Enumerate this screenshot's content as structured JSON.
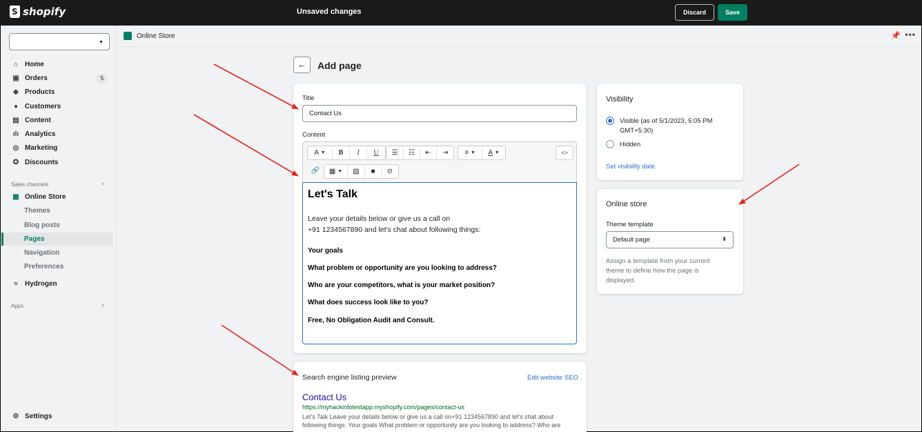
{
  "topbar": {
    "logo_text": "shopify",
    "status": "Unsaved changes",
    "discard_label": "Discard",
    "save_label": "Save"
  },
  "sidebar": {
    "store_select_value": "",
    "nav": [
      {
        "label": "Home",
        "icon": "home-icon"
      },
      {
        "label": "Orders",
        "icon": "orders-icon",
        "badge": "5"
      },
      {
        "label": "Products",
        "icon": "products-icon"
      },
      {
        "label": "Customers",
        "icon": "customers-icon"
      },
      {
        "label": "Content",
        "icon": "content-icon"
      },
      {
        "label": "Analytics",
        "icon": "analytics-icon"
      },
      {
        "label": "Marketing",
        "icon": "marketing-icon"
      },
      {
        "label": "Discounts",
        "icon": "discounts-icon"
      }
    ],
    "sales_channels_label": "Sales channels",
    "online_store_label": "Online Store",
    "online_store_sub": [
      "Themes",
      "Blog posts",
      "Pages",
      "Navigation",
      "Preferences"
    ],
    "active_sub": "Pages",
    "hydrogen_label": "Hydrogen",
    "apps_label": "Apps",
    "settings_label": "Settings"
  },
  "breadcrumb": {
    "label": "Online Store"
  },
  "page": {
    "title": "Add page"
  },
  "main_card": {
    "title_label": "Title",
    "title_value": "Contact Us",
    "content_label": "Content",
    "editor": {
      "heading": "Let's Talk",
      "para_line1": "Leave your details below or give us a call on",
      "para_line2": "+91 1234567890 and let's chat about following things:",
      "bold_items": [
        "Your goals",
        "What problem or opportunity are you looking to address?",
        "Who are your competitors, what is your market position?",
        "What does success look like to you?",
        "Free, No Obligation Audit and Consult."
      ]
    },
    "toolbar": {
      "font_label": "A",
      "bold_label": "B",
      "italic_label": "I",
      "underline_label": "U",
      "color_label": "A",
      "html_label": "<>"
    }
  },
  "seo_card": {
    "heading": "Search engine listing preview",
    "edit_link": "Edit website SEO",
    "preview_title": "Contact Us",
    "preview_url": "https://myhackinfotestapp.myshopify.com/pages/contact-us",
    "preview_desc": "Let's Talk Leave your details below or give us a call on+91 1234567890 and let's chat about following things: Your goals What problem or opportunity are you looking to address? Who are"
  },
  "visibility_card": {
    "heading": "Visibility",
    "visible_label": "Visible (as of 5/1/2023, 5:05 PM",
    "visible_label_2": "GMT+5:30)",
    "hidden_label": "Hidden",
    "selected": "Visible",
    "set_date_link": "Set visibility date"
  },
  "online_store_card": {
    "heading": "Online store",
    "template_label": "Theme template",
    "template_value": "Default page",
    "help_line1": "Assign a template from your current",
    "help_line2": "theme to define how the page is",
    "help_line3": "displayed."
  },
  "colors": {
    "accent": "#008060",
    "link": "#2c6ecb",
    "annotation_arrow": "#e8211b"
  }
}
